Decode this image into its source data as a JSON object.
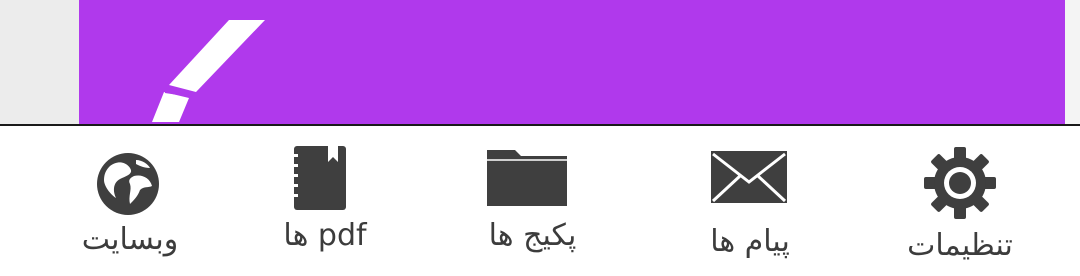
{
  "colors": {
    "accent": "#b039ec",
    "icon": "#3f3f3f",
    "label": "#3c3c3c",
    "nav_bg": "#ffffff"
  },
  "banner": {
    "icon": "pen-icon"
  },
  "nav": {
    "items": [
      {
        "id": "website",
        "label": "وبسایت",
        "icon": "globe-icon"
      },
      {
        "id": "pdf",
        "label": "pdf ها",
        "icon": "notebook-icon"
      },
      {
        "id": "packages",
        "label": "پکیج ها",
        "icon": "folder-icon"
      },
      {
        "id": "messages",
        "label": "پیام ها",
        "icon": "envelope-icon"
      },
      {
        "id": "settings",
        "label": "تنظیمات",
        "icon": "gear-icon"
      }
    ]
  }
}
